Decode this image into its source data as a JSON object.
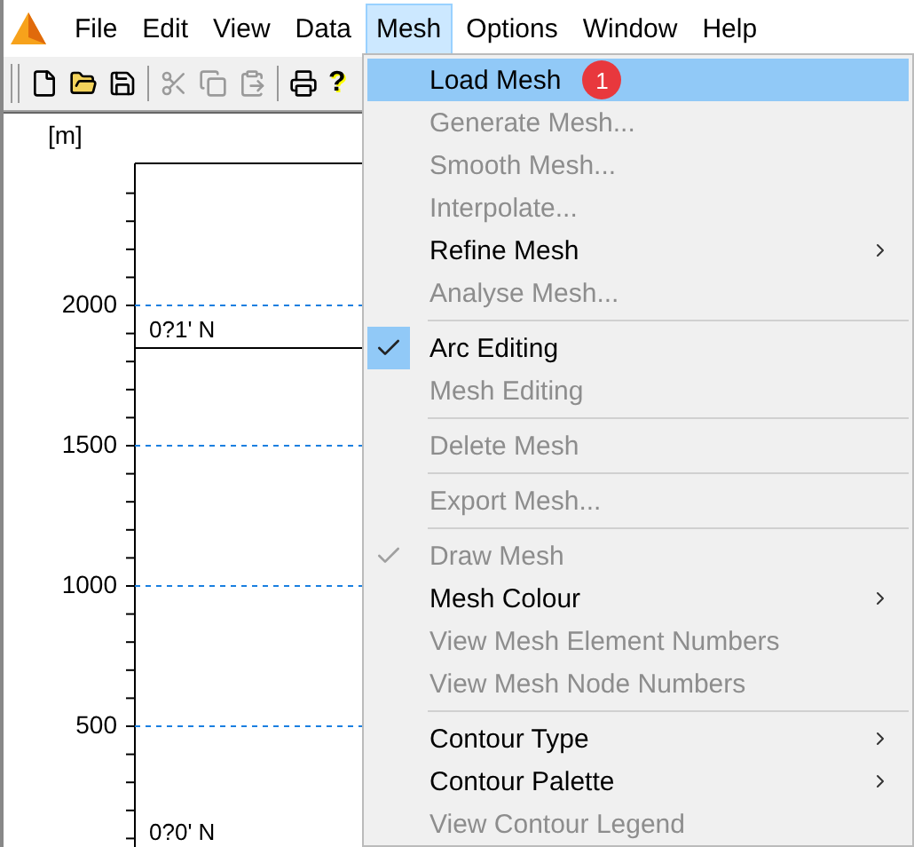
{
  "menu_bar": [
    {
      "label": "File",
      "selected": false
    },
    {
      "label": "Edit",
      "selected": false
    },
    {
      "label": "View",
      "selected": false
    },
    {
      "label": "Data",
      "selected": false
    },
    {
      "label": "Mesh",
      "selected": true
    },
    {
      "label": "Options",
      "selected": false
    },
    {
      "label": "Window",
      "selected": false
    },
    {
      "label": "Help",
      "selected": false
    }
  ],
  "toolbar": [
    {
      "kind": "new",
      "disabled": false
    },
    {
      "kind": "open",
      "disabled": false
    },
    {
      "kind": "save",
      "disabled": false
    },
    {
      "kind": "sep"
    },
    {
      "kind": "cut",
      "disabled": true
    },
    {
      "kind": "copy",
      "disabled": true
    },
    {
      "kind": "paste",
      "disabled": true
    },
    {
      "kind": "sep"
    },
    {
      "kind": "print",
      "disabled": false
    },
    {
      "kind": "help",
      "disabled": false,
      "label": "?"
    }
  ],
  "plot": {
    "unit": "[m]",
    "ticks": [
      {
        "label": "2000"
      },
      {
        "label": "1500"
      },
      {
        "label": "1000"
      },
      {
        "label": "500"
      }
    ],
    "lines": [
      {
        "label": "0?1' N"
      },
      {
        "label": "0?0' N"
      }
    ]
  },
  "mesh_menu": [
    {
      "kind": "item",
      "label": "Load Mesh",
      "disabled": false,
      "selected": true,
      "badge": "1"
    },
    {
      "kind": "item",
      "label": "Generate Mesh...",
      "disabled": true,
      "selected": false
    },
    {
      "kind": "item",
      "label": "Smooth Mesh...",
      "disabled": true,
      "selected": false
    },
    {
      "kind": "item",
      "label": "Interpolate...",
      "disabled": true,
      "selected": false
    },
    {
      "kind": "item",
      "label": "Refine Mesh",
      "disabled": false,
      "selected": false,
      "submenu": true
    },
    {
      "kind": "item",
      "label": "Analyse Mesh...",
      "disabled": true,
      "selected": false
    },
    {
      "kind": "sep"
    },
    {
      "kind": "item",
      "label": "Arc Editing",
      "disabled": false,
      "selected": false,
      "checked": true
    },
    {
      "kind": "item",
      "label": "Mesh Editing",
      "disabled": true,
      "selected": false
    },
    {
      "kind": "sep"
    },
    {
      "kind": "item",
      "label": "Delete Mesh",
      "disabled": true,
      "selected": false
    },
    {
      "kind": "sep"
    },
    {
      "kind": "item",
      "label": "Export Mesh...",
      "disabled": true,
      "selected": false
    },
    {
      "kind": "sep"
    },
    {
      "kind": "item",
      "label": "Draw Mesh",
      "disabled": true,
      "selected": false,
      "checked": true
    },
    {
      "kind": "item",
      "label": "Mesh Colour",
      "disabled": false,
      "selected": false,
      "submenu": true
    },
    {
      "kind": "item",
      "label": "View Mesh Element Numbers",
      "disabled": true,
      "selected": false
    },
    {
      "kind": "item",
      "label": "View Mesh Node Numbers",
      "disabled": true,
      "selected": false
    },
    {
      "kind": "sep"
    },
    {
      "kind": "item",
      "label": "Contour Type",
      "disabled": false,
      "selected": false,
      "submenu": true
    },
    {
      "kind": "item",
      "label": "Contour Palette",
      "disabled": false,
      "selected": false,
      "submenu": true
    },
    {
      "kind": "item",
      "label": "View Contour Legend",
      "disabled": true,
      "selected": false
    }
  ]
}
